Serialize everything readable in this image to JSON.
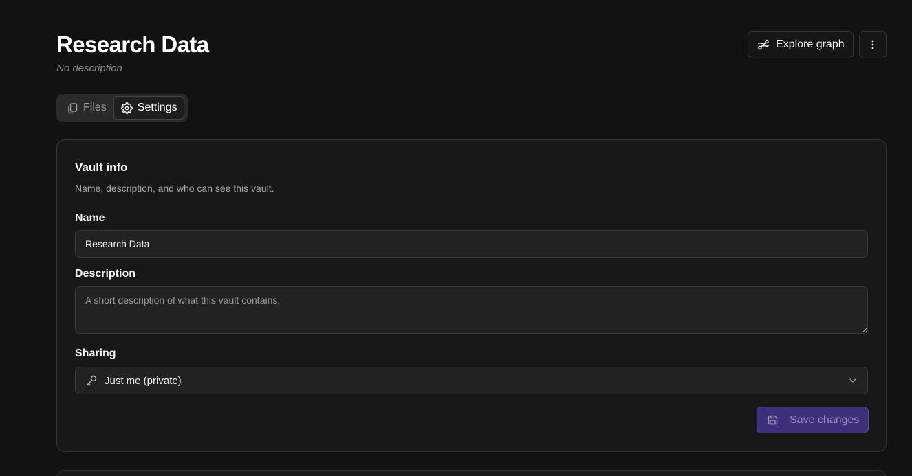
{
  "header": {
    "title": "Research Data",
    "subtitle": "No description",
    "explore_label": "Explore graph",
    "more_icon": "more-vertical-icon"
  },
  "tabs": [
    {
      "label": "Files",
      "icon": "files-icon",
      "active": false
    },
    {
      "label": "Settings",
      "icon": "gear-icon",
      "active": true
    }
  ],
  "vault_info": {
    "title": "Vault info",
    "description": "Name, description, and who can see this vault.",
    "name_label": "Name",
    "name_value": "Research Data",
    "description_label": "Description",
    "description_placeholder": "A short description of what this vault contains.",
    "sharing_label": "Sharing",
    "sharing_value": "Just me (private)",
    "save_label": "Save changes"
  },
  "colors": {
    "background": "#121212",
    "card": "#181818",
    "accent": "#3d2f7a"
  }
}
